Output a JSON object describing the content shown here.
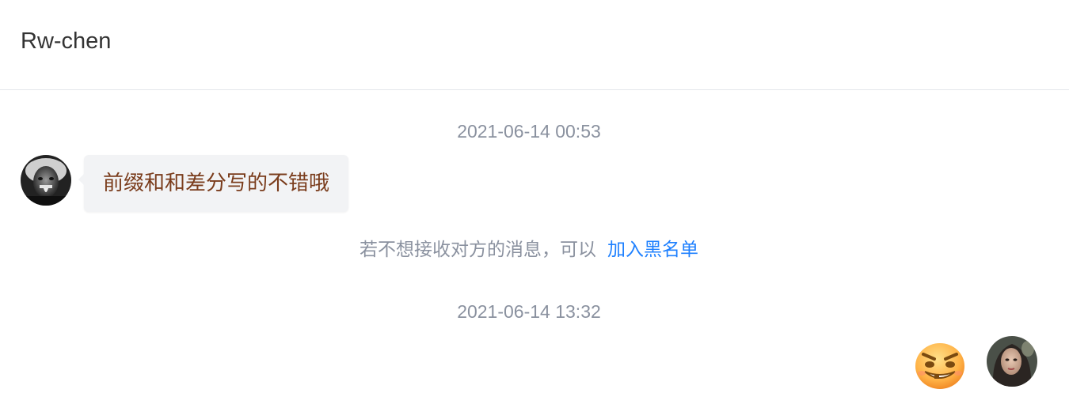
{
  "header": {
    "title": "Rw-chen"
  },
  "messages": [
    {
      "timestamp": "2021-06-14 00:53",
      "sender": "other",
      "text": "前缀和和差分写的不错哦"
    }
  ],
  "system_notice": {
    "text": "若不想接收对方的消息，可以",
    "link_label": "加入黑名单"
  },
  "second_timestamp": "2021-06-14 13:32",
  "self_message": {
    "content_icon": "grinning-emoji-sticker"
  },
  "colors": {
    "timestamp": "#8a919f",
    "bubble_bg": "#f2f3f5",
    "bubble_text": "#7a3c1c",
    "link": "#1e80ff",
    "divider": "#e4e6eb"
  }
}
